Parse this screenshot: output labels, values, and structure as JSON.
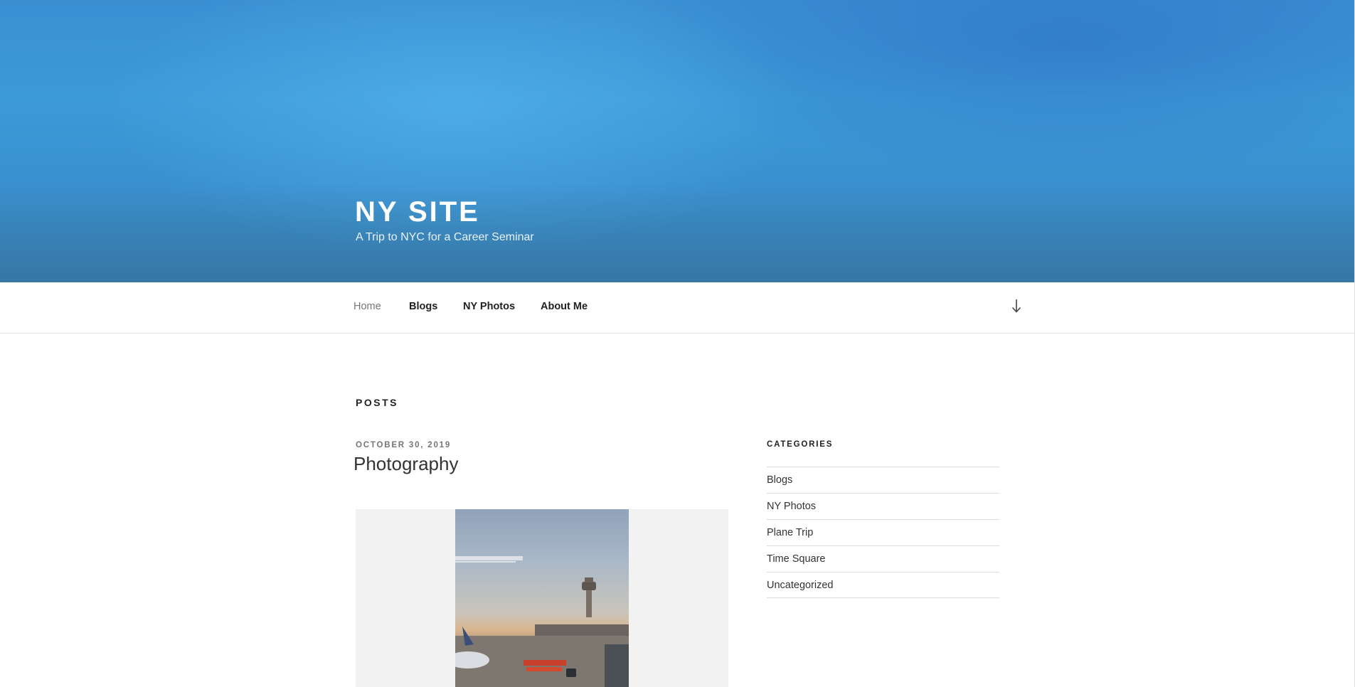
{
  "header": {
    "site_title": "NY SITE",
    "site_description": "A Trip to NYC for a Career Seminar"
  },
  "nav": {
    "items": [
      {
        "label": "Home",
        "current": true
      },
      {
        "label": "Blogs"
      },
      {
        "label": "NY Photos"
      },
      {
        "label": "About Me"
      }
    ],
    "scroll_icon": "arrow-down-icon"
  },
  "main": {
    "section_title": "POSTS",
    "post": {
      "date": "OCTOBER 30, 2019",
      "title": "Photography",
      "image_subject": "airport control tower"
    }
  },
  "sidebar": {
    "widget_title": "CATEGORIES",
    "categories": [
      "Blogs",
      "NY Photos",
      "Plane Trip",
      "Time Square",
      "Uncategorized"
    ]
  },
  "colors": {
    "header_blue": "#3b90d2",
    "text_dark": "#222222",
    "text_muted": "#767676",
    "divider": "#dddddd"
  }
}
